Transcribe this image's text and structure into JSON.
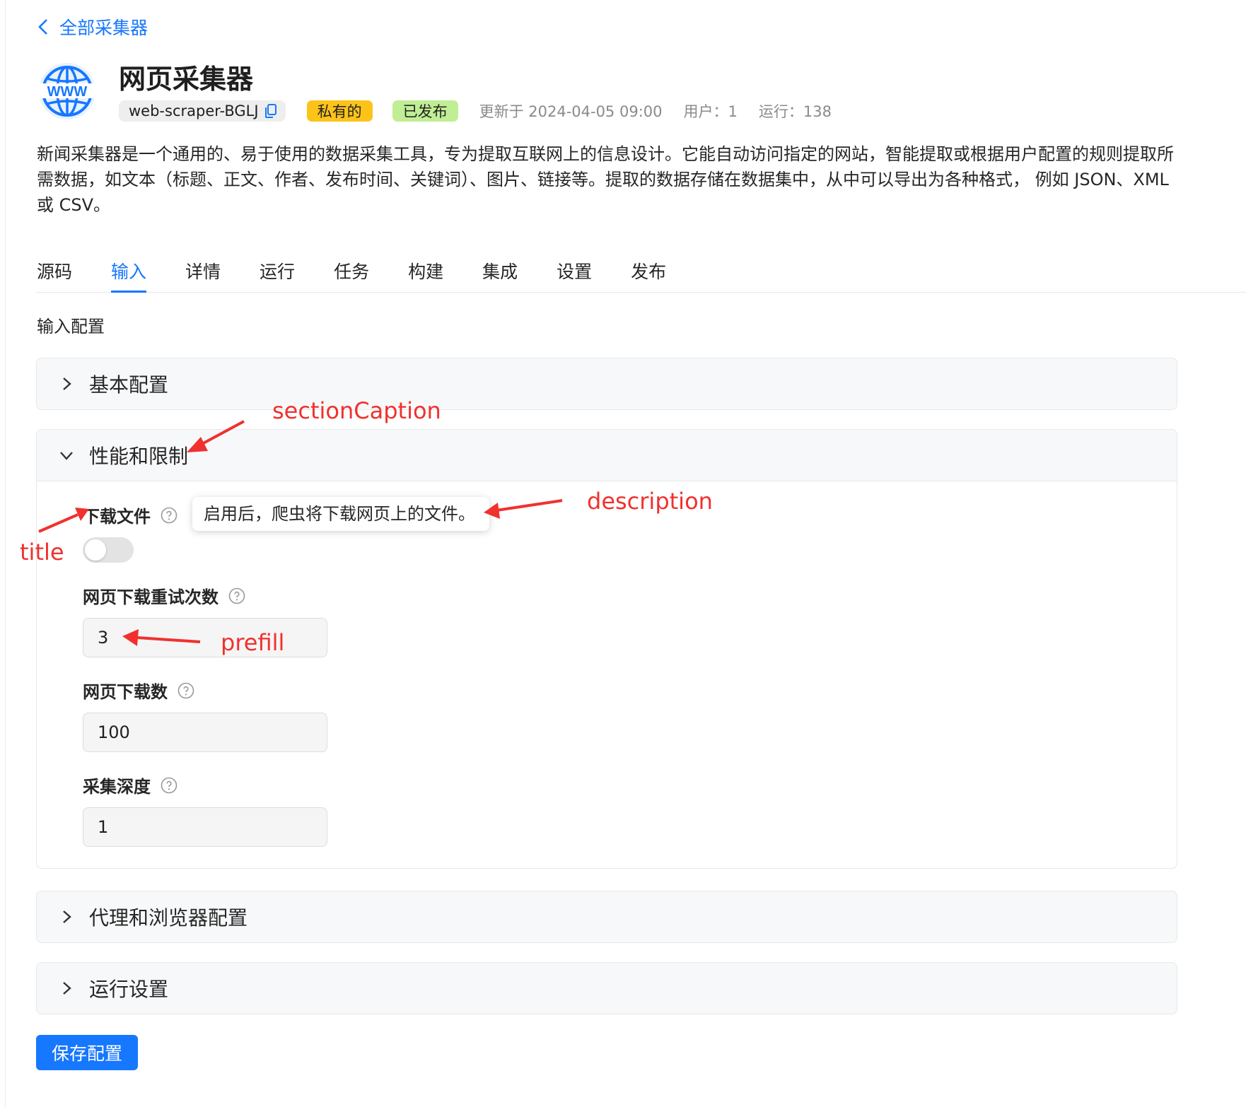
{
  "header": {
    "back_label": "全部采集器",
    "title": "网页采集器",
    "id_chip": "web-scraper-BGLJ",
    "tag_private": "私有的",
    "tag_published": "已发布",
    "updated": "更新于 2024-04-05 09:00",
    "users": "用户：1",
    "runs": "运行：138",
    "description": "新闻采集器是一个通用的、易于使用的数据采集工具，专为提取互联网上的信息设计。它能自动访问指定的网站，智能提取或根据用户配置的规则提取所需数据，如文本（标题、正文、作者、发布时间、关键词）、图片、链接等。提取的数据存储在数据集中，从中可以导出为各种格式， 例如 JSON、XML 或 CSV。"
  },
  "tabs": [
    {
      "label": "源码",
      "active": false
    },
    {
      "label": "输入",
      "active": true
    },
    {
      "label": "详情",
      "active": false
    },
    {
      "label": "运行",
      "active": false
    },
    {
      "label": "任务",
      "active": false
    },
    {
      "label": "构建",
      "active": false
    },
    {
      "label": "集成",
      "active": false
    },
    {
      "label": "设置",
      "active": false
    },
    {
      "label": "发布",
      "active": false
    }
  ],
  "input_config": {
    "heading": "输入配置",
    "sections": [
      {
        "caption": "基本配置",
        "expanded": false
      },
      {
        "caption": "性能和限制",
        "expanded": true
      },
      {
        "caption": "代理和浏览器配置",
        "expanded": false
      },
      {
        "caption": "运行设置",
        "expanded": false
      }
    ],
    "fields": {
      "download_files": {
        "title": "下载文件",
        "description": "启用后，爬虫将下载网页上的文件。",
        "enabled": false
      },
      "retry_count": {
        "title": "网页下载重试次数",
        "value": "3"
      },
      "page_count": {
        "title": "网页下载数",
        "value": "100"
      },
      "depth": {
        "title": "采集深度",
        "value": "1"
      }
    },
    "save_label": "保存配置"
  },
  "annotations": {
    "section_caption": "sectionCaption",
    "description": "description",
    "title": "title",
    "prefill": "prefill"
  },
  "colors": {
    "accent": "#1677ff",
    "tag_private": "#fcc419",
    "tag_published": "#c0ee94",
    "annotation": "#f0312e"
  },
  "icons": [
    "chevron-left-icon",
    "globe-www-icon",
    "copy-icon",
    "chevron-right-icon",
    "chevron-down-icon",
    "help-circle-icon"
  ]
}
